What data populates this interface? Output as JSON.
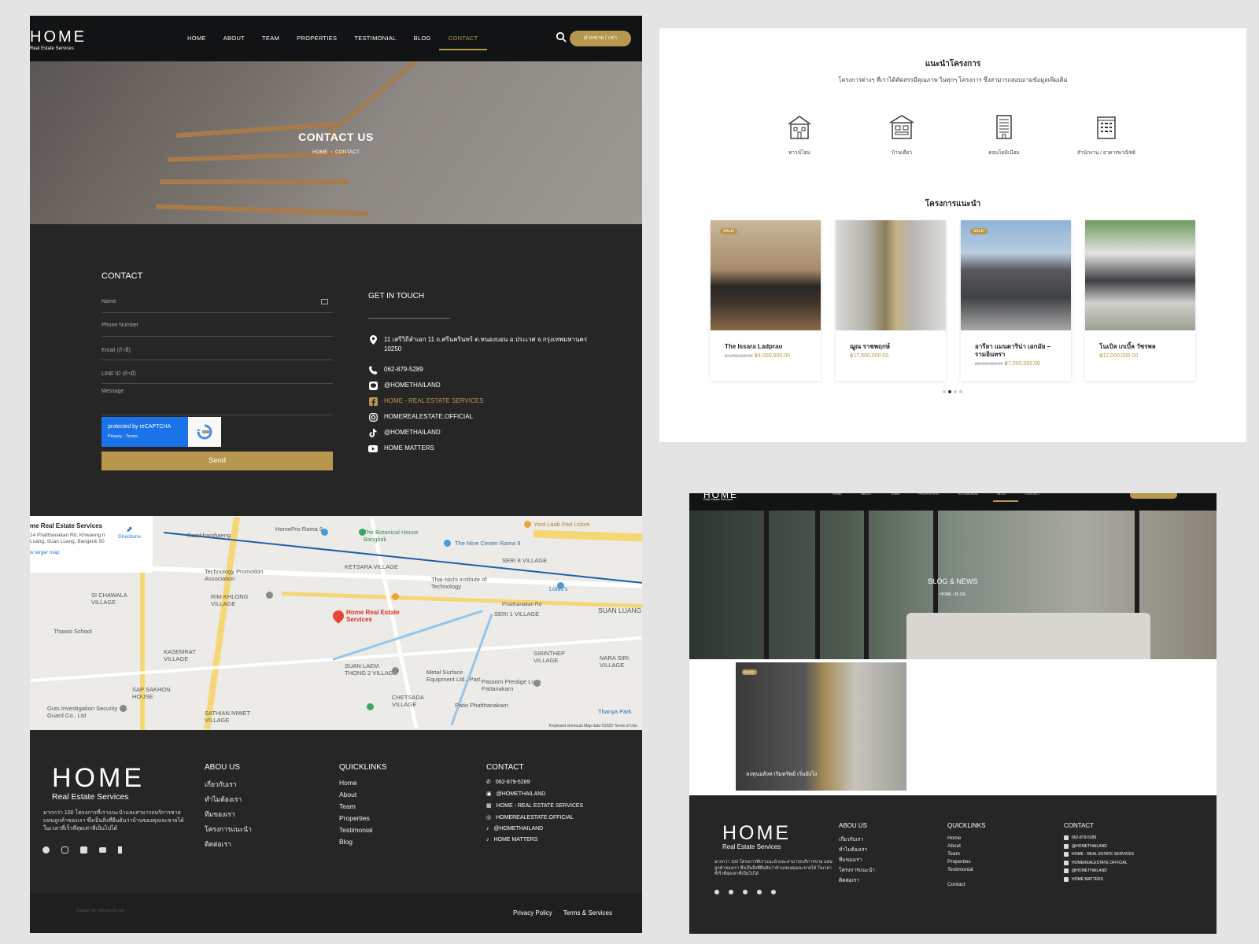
{
  "nav": {
    "logo": "HOME",
    "logo_sub": "Real Estate Services",
    "items": [
      "HOME",
      "ABOUT",
      "TEAM",
      "PROPERTIES",
      "TESTIMONIAL",
      "BLOG",
      "CONTACT"
    ],
    "active": "CONTACT",
    "cta_label": "ฝากขาย / เช่า",
    "search_icon": "search-icon"
  },
  "hero": {
    "title": "CONTACT US",
    "crumb_home": "HOME",
    "crumb_current": "CONTACT"
  },
  "contact_form": {
    "heading": "CONTACT",
    "fields": [
      "Name",
      "Phone Number",
      "Email (ถ้ามี)",
      "LINE ID (ถ้ามี)",
      "Message"
    ],
    "recaptcha_label": "protected by reCAPTCHA",
    "recaptcha_links": "Privacy - Terms",
    "send_label": "Send"
  },
  "get_in_touch": {
    "heading": "GET IN TOUCH",
    "items": [
      {
        "icon": "location-icon",
        "text": "11 เสรีวิถีลำเอก 11 ถ.ศรีนครินทร์ ต.หนองบอน อ.ประเวศ จ.กรุงเทพมหานคร 10250"
      },
      {
        "icon": "phone-icon",
        "text": "062-879-5289"
      },
      {
        "icon": "line-icon",
        "text": "@HOMETHAILAND"
      },
      {
        "icon": "facebook-icon",
        "text": "HOME - REAL ESTATE SERVICES",
        "highlight": true
      },
      {
        "icon": "instagram-icon",
        "text": "HOMEREALESTATE.OFFICIAL"
      },
      {
        "icon": "tiktok-icon",
        "text": "@HOMETHAILAND"
      },
      {
        "icon": "youtube-icon",
        "text": "HOME MATTERS"
      }
    ]
  },
  "map": {
    "card_title": "me Real Estate Services",
    "card_address": "14 Phatthanakan Rd, Khwaeng n Luang, Suan Luang, Bangkok 50",
    "card_link": "w larger map",
    "directions": "Directions",
    "marker_label": "Home Real Estate Services",
    "labels": [
      "Ramkhamhaeng",
      "HomePro Rama 9",
      "The Botanical House Bangkok",
      "Yord Laab Ped Udom",
      "The Nine Center Rama 9",
      "KETSARA VILLAGE",
      "SERI 8 VILLAGE",
      "Technology Promotion Association",
      "Thai-Nichi Institute of Technology",
      "Lotus's",
      "SI CHAWALA VILLAGE",
      "RIM KHLONG VILLAGE",
      "Phatthanakan Rd",
      "SERI 1 VILLAGE",
      "SUAN LUANG",
      "Thawsi School",
      "KASEMRAT VILLAGE",
      "SUAN LAEM THONG 2 VILLAGE",
      "Metal Surface Equipment Ltd., Part.",
      "SIRINTHEP VILLAGE",
      "NARA SIRI VILLAGE",
      "SAP SAKHON HOUSE",
      "Passorn Prestige Luxe Pattanakarn",
      "Guts Investigation Security Guard Co., Ltd",
      "SATHIAN NIWET VILLAGE",
      "CHETSADA VILLAGE",
      "Patio Phatthanakarn",
      "Thanya Park"
    ],
    "footer": "Keyboard shortcuts   Map data ©2022   Terms of Use"
  },
  "footer": {
    "logo": "HOME",
    "logo_sub": "Real Estate Services",
    "desc": "มากกว่า 100 โครงการที่เราแนะนำและสามารถบริการขาย แทนลูกค้าของเรา ซึ่งเป็นสิ่งที่ยืนยันว่าบ้านของคุณจะขายได้ ในเวลาที่เร็วที่สุดเท่าที่เป็นไปได้",
    "about_heading": "ABOU US",
    "about_items": [
      "เกี่ยวกับเรา",
      "ทำไมต้องเรา",
      "ทีมของเรา",
      "โครงการแนะนำ",
      "ติดต่อเรา"
    ],
    "quick_heading": "QUICKLINKS",
    "quick_items": [
      "Home",
      "About",
      "Team",
      "Properties",
      "Testimonial",
      "Blog"
    ],
    "contact_heading": "CONTACT",
    "contact_items": [
      "062-879-5289",
      "@HOMETHAILAND",
      "HOME - REAL ESTATE SERVICES",
      "HOMEREALESTATE.OFFICIAL",
      "@HOMETHAILAND",
      "HOME MATTERS"
    ],
    "credit": "Design by nContent.com",
    "privacy": "Privacy Policy",
    "terms": "Terms & Services"
  },
  "projects": {
    "title": "แนะนำโครงการ",
    "subtitle": "โครงการต่างๆ ที่เราได้คัดสรรมีคุณภาพ ในทุกๆ โครงการ ซึ่งสามารถสอบถามข้อมูลเพิ่มเติม",
    "categories": [
      "ทาวน์โฮม",
      "บ้านเดี่ยว",
      "คอนโดมิเนียม",
      "สำนักงาน / อาคารพาณิชย์"
    ],
    "featured_title": "โครงการแนะนำ",
    "cards": [
      {
        "name": "The Issara Ladprao",
        "old_price": "฿4,200,000.00",
        "price": "฿4,000,000.00",
        "sale": true
      },
      {
        "name": "ฌูณ ราชพฤกษ์",
        "old_price": "",
        "price": "฿17,500,000.00",
        "sale": false
      },
      {
        "name": "อารียา แมนดาริน่า เอกมัย – รามอินทรา",
        "old_price": "฿8,000,000.00",
        "price": "฿7,900,000.00",
        "sale": true
      },
      {
        "name": "โนเบิล เกเบิ้ล วัชรพล",
        "old_price": "",
        "price": "฿12,000,000.00",
        "sale": false
      }
    ],
    "sale_label": "SALE!"
  },
  "blog": {
    "title": "BLOG & NEWS",
    "crumb_home": "HOME",
    "crumb_current": "BLOG",
    "tag": "BLOG",
    "post_title": "ลงทุนอสังหาริมทรัพย์ เริ่มยังไง",
    "footer_logo": "HOME",
    "footer_logo_sub": "Real Estate Services",
    "about_heading": "ABOU US",
    "quick_heading": "QUICKLINKS",
    "quick_items": [
      "Home",
      "About",
      "Team",
      "Properties",
      "Testimonial",
      "",
      "Contact"
    ],
    "contact_heading": "CONTACT"
  },
  "colors": {
    "gold": "#b8974f",
    "dark": "#262626",
    "nav": "#111315"
  }
}
